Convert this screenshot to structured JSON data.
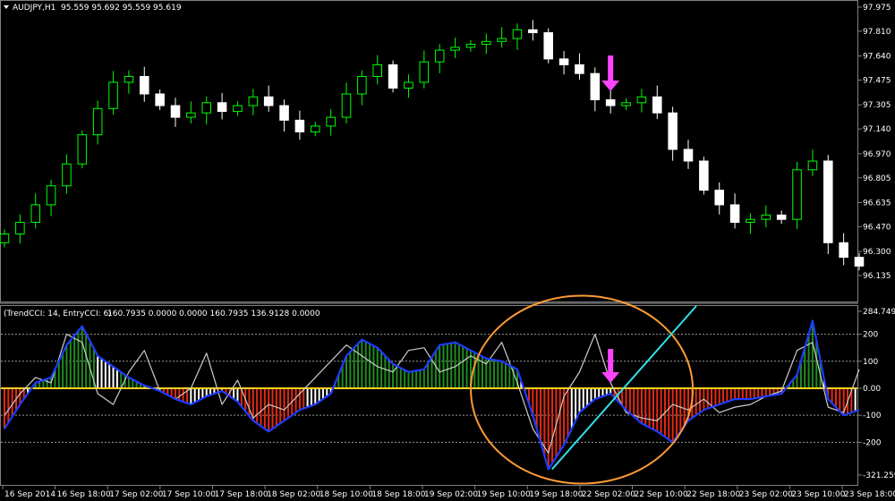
{
  "header": {
    "symbol": "AUDJPY,H1",
    "ohlc": "95.559 95.692 95.559 95.619"
  },
  "indicator_header": {
    "name": "(TrendCCI: 14, EntryCCI: 6)",
    "values": "160.7935 0.0000 0.0000 160.7935 136.9128 0.0000"
  },
  "chart_data": [
    {
      "type": "candlestick",
      "title": "AUDJPY,H1",
      "ylim": [
        96.05,
        98.06
      ],
      "y_ticks": [
        "97.975",
        "97.810",
        "97.640",
        "97.475",
        "97.305",
        "97.140",
        "96.970",
        "96.805",
        "96.635",
        "96.470",
        "96.300",
        "96.135"
      ],
      "x_ticks": [
        "16 Sep 2014",
        "16 Sep 18:00",
        "17 Sep 02:00",
        "17 Sep 10:00",
        "17 Sep 18:00",
        "18 Sep 02:00",
        "18 Sep 10:00",
        "18 Sep 18:00",
        "19 Sep 02:00",
        "19 Sep 10:00",
        "19 Sep 18:00",
        "22 Sep 02:00",
        "22 Sep 10:00",
        "22 Sep 18:00",
        "23 Sep 02:00",
        "23 Sep 10:00",
        "23 Sep 18:00"
      ],
      "color_up": "#00ff00",
      "color_down": "#ffffff",
      "close": [
        96.42,
        96.5,
        96.62,
        96.75,
        96.9,
        97.1,
        97.28,
        97.46,
        97.5,
        97.38,
        97.3,
        97.22,
        97.25,
        97.32,
        97.26,
        97.3,
        97.36,
        97.3,
        97.2,
        97.12,
        97.16,
        97.22,
        97.38,
        97.5,
        97.58,
        97.42,
        97.46,
        97.6,
        97.68,
        97.7,
        97.72,
        97.74,
        97.76,
        97.82,
        97.8,
        97.62,
        97.58,
        97.52,
        97.34,
        97.3,
        97.32,
        97.36,
        97.25,
        97.0,
        96.92,
        96.72,
        96.62,
        96.5,
        96.52,
        96.55,
        96.52,
        96.86,
        96.92,
        96.36,
        96.26,
        96.2
      ],
      "marker_bar": 39,
      "marker_color": "#ff44ff"
    },
    {
      "type": "histogram_line",
      "title": "(TrendCCI: 14, EntryCCI: 6)",
      "ylim": [
        -321.2598,
        284.7494
      ],
      "y_ticks": [
        "284.7494",
        "200",
        "100",
        "0.00",
        "-100",
        "-200",
        "-321.2598"
      ],
      "zero_line_color": "#ffd21e",
      "series": [
        {
          "name": "TrendCCI",
          "color": "#1e3cff",
          "values": [
            -150,
            -60,
            20,
            40,
            160,
            230,
            120,
            80,
            40,
            10,
            -10,
            -40,
            -60,
            -30,
            -10,
            -50,
            -120,
            -160,
            -120,
            -80,
            -60,
            -20,
            120,
            180,
            150,
            90,
            60,
            70,
            160,
            170,
            140,
            110,
            100,
            70,
            -100,
            -300,
            -210,
            -90,
            -40,
            -20,
            -80,
            -130,
            -160,
            -200,
            -120,
            -80,
            -60,
            -40,
            -40,
            -30,
            -20,
            50,
            250,
            -40,
            -100,
            -80
          ]
        },
        {
          "name": "EntryCCI",
          "color": "#cccccc",
          "values": [
            -100,
            -20,
            40,
            20,
            200,
            170,
            -20,
            -60,
            60,
            140,
            -10,
            -40,
            0,
            130,
            -60,
            30,
            -110,
            -60,
            -80,
            -20,
            40,
            100,
            160,
            120,
            80,
            60,
            140,
            150,
            60,
            80,
            120,
            90,
            170,
            20,
            -150,
            -240,
            -30,
            60,
            200,
            20,
            -90,
            -110,
            -120,
            -60,
            -80,
            -40,
            -90,
            -70,
            -60,
            -30,
            -10,
            140,
            170,
            -70,
            -90,
            70
          ]
        }
      ],
      "bar_colors": {
        "up_strong": "#1f8c1f",
        "up_weak": "#ffffff",
        "down_strong": "#e52a14",
        "down_weak": "#ffffff",
        "transition": "#ffd21e"
      },
      "marker_bar": 39,
      "marker_color": "#ff44ff",
      "annotations": [
        {
          "type": "ellipse",
          "color": "#ff9a33"
        },
        {
          "type": "trendline",
          "color": "#33e0e8"
        }
      ]
    }
  ]
}
